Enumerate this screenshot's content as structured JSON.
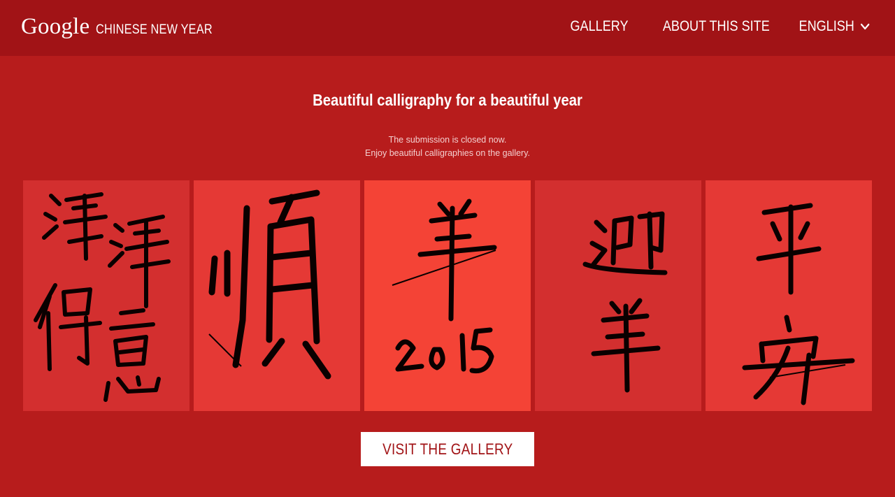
{
  "header": {
    "logo_text": "Google",
    "site_name": "CHINESE NEW YEAR",
    "nav": [
      {
        "label": "GALLERY"
      },
      {
        "label": "ABOUT THIS SITE"
      },
      {
        "label": "ENGLISH",
        "icon": "chevron-down-icon"
      }
    ]
  },
  "main": {
    "headline": "Beautiful calligraphy for a beautiful year",
    "notice_line1": "The submission is closed now.",
    "notice_line2": "Enjoy beautiful calligraphies on the gallery.",
    "cards": [
      {
        "text": "洋洋得意",
        "bg": "#d32f2f"
      },
      {
        "text": "顺",
        "bg": "#e53935"
      },
      {
        "text": "羊 2015",
        "bg": "#f44336"
      },
      {
        "text": "迎羊",
        "bg": "#d32f2f"
      },
      {
        "text": "平安",
        "bg": "#e53935"
      }
    ],
    "cta_label": "VISIT THE GALLERY"
  },
  "colors": {
    "header_bg": "#a11316",
    "page_bg": "#b71c1c",
    "cta_bg": "#ffffff",
    "cta_text": "#a11316"
  }
}
